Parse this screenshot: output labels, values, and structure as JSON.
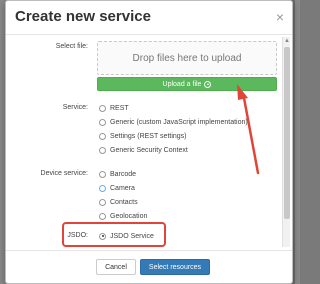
{
  "modal": {
    "title": "Create new service",
    "close_glyph": "×"
  },
  "select_file": {
    "label": "Select file:",
    "dropzone_text": "Drop files here to upload",
    "upload_button": "Upload a file",
    "upload_icon": "upload-circle-icon"
  },
  "service": {
    "label": "Service:",
    "options": [
      {
        "label": "REST",
        "checked": false
      },
      {
        "label": "Generic (custom JavaScript implementation)",
        "checked": false
      },
      {
        "label": "Settings (REST settings)",
        "checked": false
      },
      {
        "label": "Generic Security Context",
        "checked": false
      }
    ]
  },
  "device_service": {
    "label": "Device service:",
    "options": [
      {
        "label": "Barcode",
        "checked": false
      },
      {
        "label": "Camera",
        "checked": false,
        "focused": true
      },
      {
        "label": "Contacts",
        "checked": false
      },
      {
        "label": "Geolocation",
        "checked": false
      }
    ]
  },
  "jsdo": {
    "label": "JSDO:",
    "options": [
      {
        "label": "JSDO Service",
        "checked": true
      }
    ]
  },
  "footer": {
    "cancel_label": "Cancel",
    "primary_label": "Select resources"
  },
  "colors": {
    "primary": "#337ab7",
    "success": "#5cb85c",
    "annotation": "#e0453a"
  }
}
